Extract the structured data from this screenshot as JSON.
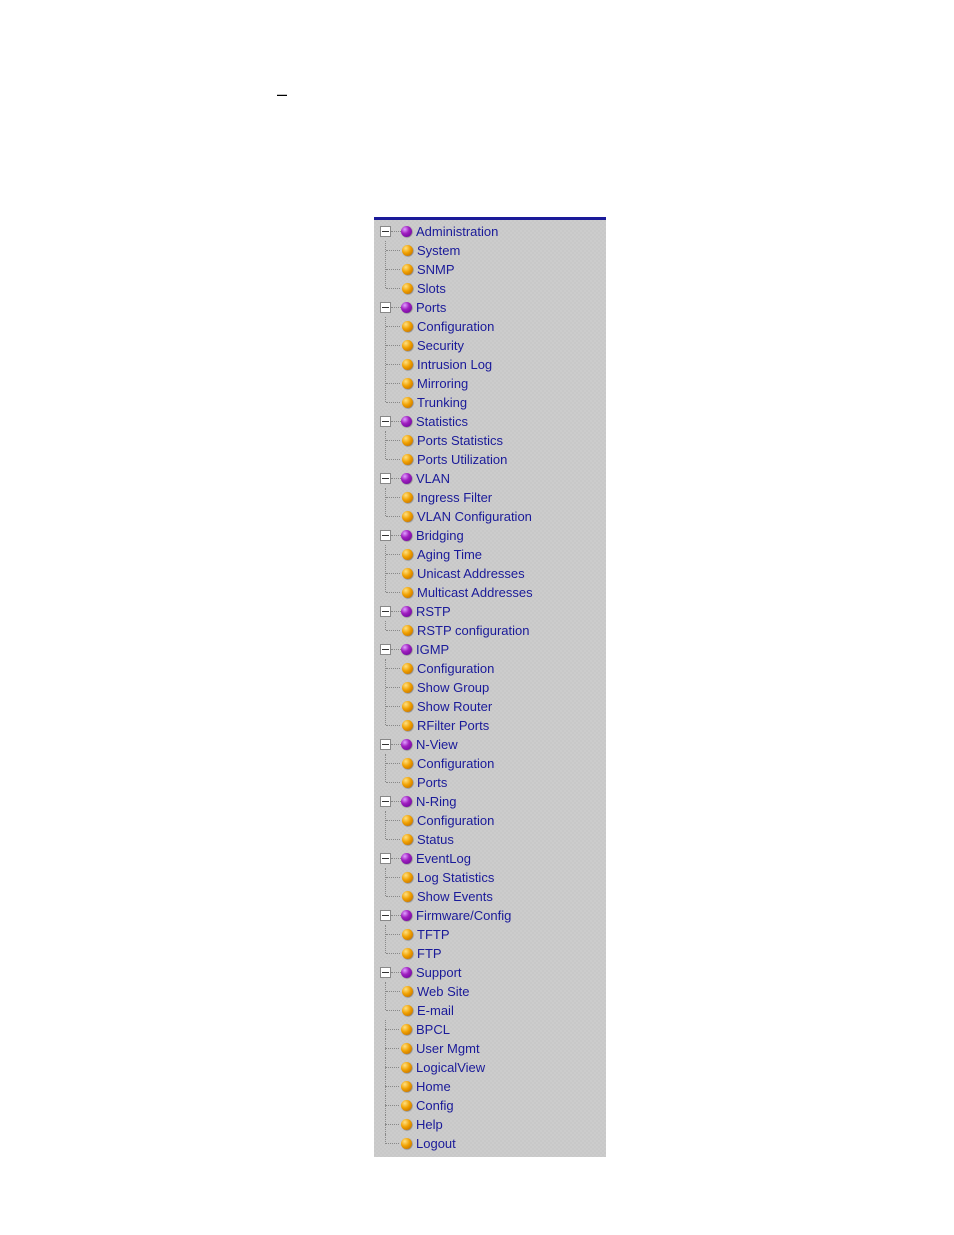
{
  "tree": {
    "branches": [
      {
        "label": "Administration",
        "children": [
          "System",
          "SNMP",
          "Slots"
        ]
      },
      {
        "label": "Ports",
        "children": [
          "Configuration",
          "Security",
          "Intrusion Log",
          "Mirroring",
          "Trunking"
        ]
      },
      {
        "label": "Statistics",
        "children": [
          "Ports Statistics",
          "Ports Utilization"
        ]
      },
      {
        "label": "VLAN",
        "children": [
          "Ingress Filter",
          "VLAN Configuration"
        ]
      },
      {
        "label": "Bridging",
        "children": [
          "Aging Time",
          "Unicast Addresses",
          "Multicast Addresses"
        ]
      },
      {
        "label": "RSTP",
        "children": [
          "RSTP configuration"
        ]
      },
      {
        "label": "IGMP",
        "children": [
          "Configuration",
          "Show Group",
          "Show Router",
          "RFilter Ports"
        ]
      },
      {
        "label": "N-View",
        "children": [
          "Configuration",
          "Ports"
        ]
      },
      {
        "label": "N-Ring",
        "children": [
          "Configuration",
          "Status"
        ]
      },
      {
        "label": "EventLog",
        "children": [
          "Log Statistics",
          "Show Events"
        ]
      },
      {
        "label": "Firmware/Config",
        "children": [
          "TFTP",
          "FTP"
        ]
      },
      {
        "label": "Support",
        "children": [
          "Web Site",
          "E-mail"
        ]
      }
    ],
    "flat": [
      "BPCL",
      "User Mgmt",
      "LogicalView",
      "Home",
      "Config",
      "Help",
      "Logout"
    ]
  }
}
